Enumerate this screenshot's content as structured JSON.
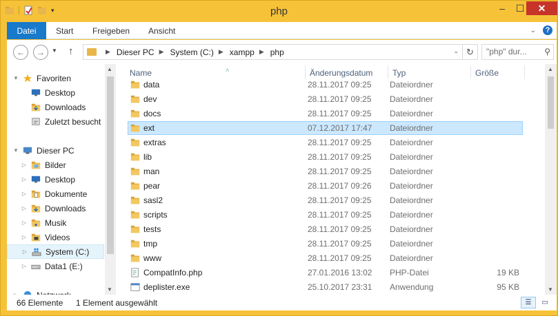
{
  "window": {
    "title": "php"
  },
  "ribbon": {
    "tabs": [
      "Datei",
      "Start",
      "Freigeben",
      "Ansicht"
    ],
    "help": "?"
  },
  "address": {
    "crumbs": [
      "Dieser PC",
      "System (C:)",
      "xampp",
      "php"
    ],
    "search_placeholder": "\"php\" dur..."
  },
  "nav_pane": {
    "items": [
      {
        "label": "Favoriten",
        "icon": "star-icon",
        "level": 0,
        "expander": "▼"
      },
      {
        "label": "Desktop",
        "icon": "desktop-icon",
        "level": 1
      },
      {
        "label": "Downloads",
        "icon": "downloads-icon",
        "level": 1
      },
      {
        "label": "Zuletzt besucht",
        "icon": "recent-icon",
        "level": 1
      },
      {
        "label": "Dieser PC",
        "icon": "computer-icon",
        "level": 0,
        "expander": "▼"
      },
      {
        "label": "Bilder",
        "icon": "pictures-icon",
        "level": 1,
        "expander": "▷"
      },
      {
        "label": "Desktop",
        "icon": "desktop-icon",
        "level": 1,
        "expander": "▷"
      },
      {
        "label": "Dokumente",
        "icon": "documents-icon",
        "level": 1,
        "expander": "▷"
      },
      {
        "label": "Downloads",
        "icon": "downloads-icon",
        "level": 1,
        "expander": "▷"
      },
      {
        "label": "Musik",
        "icon": "music-icon",
        "level": 1,
        "expander": "▷"
      },
      {
        "label": "Videos",
        "icon": "videos-icon",
        "level": 1,
        "expander": "▷"
      },
      {
        "label": "System (C:)",
        "icon": "drive-windows-icon",
        "level": 1,
        "expander": "▷",
        "selected": true
      },
      {
        "label": "Data1 (E:)",
        "icon": "drive-icon",
        "level": 1,
        "expander": "▷"
      },
      {
        "label": "Netzwerk",
        "icon": "network-icon",
        "level": 0,
        "expander": "▷"
      }
    ]
  },
  "file_list": {
    "columns": [
      "Name",
      "Änderungsdatum",
      "Typ",
      "Größe"
    ],
    "rows": [
      {
        "name": "data",
        "date": "28.11.2017 09:25",
        "type": "Dateiordner",
        "size": "",
        "icon": "folder-icon"
      },
      {
        "name": "dev",
        "date": "28.11.2017 09:25",
        "type": "Dateiordner",
        "size": "",
        "icon": "folder-icon"
      },
      {
        "name": "docs",
        "date": "28.11.2017 09:25",
        "type": "Dateiordner",
        "size": "",
        "icon": "folder-icon"
      },
      {
        "name": "ext",
        "date": "07.12.2017 17:47",
        "type": "Dateiordner",
        "size": "",
        "icon": "folder-icon",
        "selected": true
      },
      {
        "name": "extras",
        "date": "28.11.2017 09:25",
        "type": "Dateiordner",
        "size": "",
        "icon": "folder-icon"
      },
      {
        "name": "lib",
        "date": "28.11.2017 09:25",
        "type": "Dateiordner",
        "size": "",
        "icon": "folder-icon"
      },
      {
        "name": "man",
        "date": "28.11.2017 09:25",
        "type": "Dateiordner",
        "size": "",
        "icon": "folder-icon"
      },
      {
        "name": "pear",
        "date": "28.11.2017 09:26",
        "type": "Dateiordner",
        "size": "",
        "icon": "folder-icon"
      },
      {
        "name": "sasl2",
        "date": "28.11.2017 09:25",
        "type": "Dateiordner",
        "size": "",
        "icon": "folder-icon"
      },
      {
        "name": "scripts",
        "date": "28.11.2017 09:25",
        "type": "Dateiordner",
        "size": "",
        "icon": "folder-icon"
      },
      {
        "name": "tests",
        "date": "28.11.2017 09:25",
        "type": "Dateiordner",
        "size": "",
        "icon": "folder-icon"
      },
      {
        "name": "tmp",
        "date": "28.11.2017 09:25",
        "type": "Dateiordner",
        "size": "",
        "icon": "folder-icon"
      },
      {
        "name": "www",
        "date": "28.11.2017 09:25",
        "type": "Dateiordner",
        "size": "",
        "icon": "folder-icon"
      },
      {
        "name": "CompatInfo.php",
        "date": "27.01.2016 13:02",
        "type": "PHP-Datei",
        "size": "19 KB",
        "icon": "php-file-icon"
      },
      {
        "name": "deplister.exe",
        "date": "25.10.2017 23:31",
        "type": "Anwendung",
        "size": "95 KB",
        "icon": "exe-file-icon"
      }
    ]
  },
  "status": {
    "count": "66 Elemente",
    "selection": "1 Element ausgewählt"
  },
  "colors": {
    "titlebar": "#f6c238",
    "file_tab": "#1979ca",
    "selection": "#cce8ff",
    "close": "#c7342a"
  }
}
